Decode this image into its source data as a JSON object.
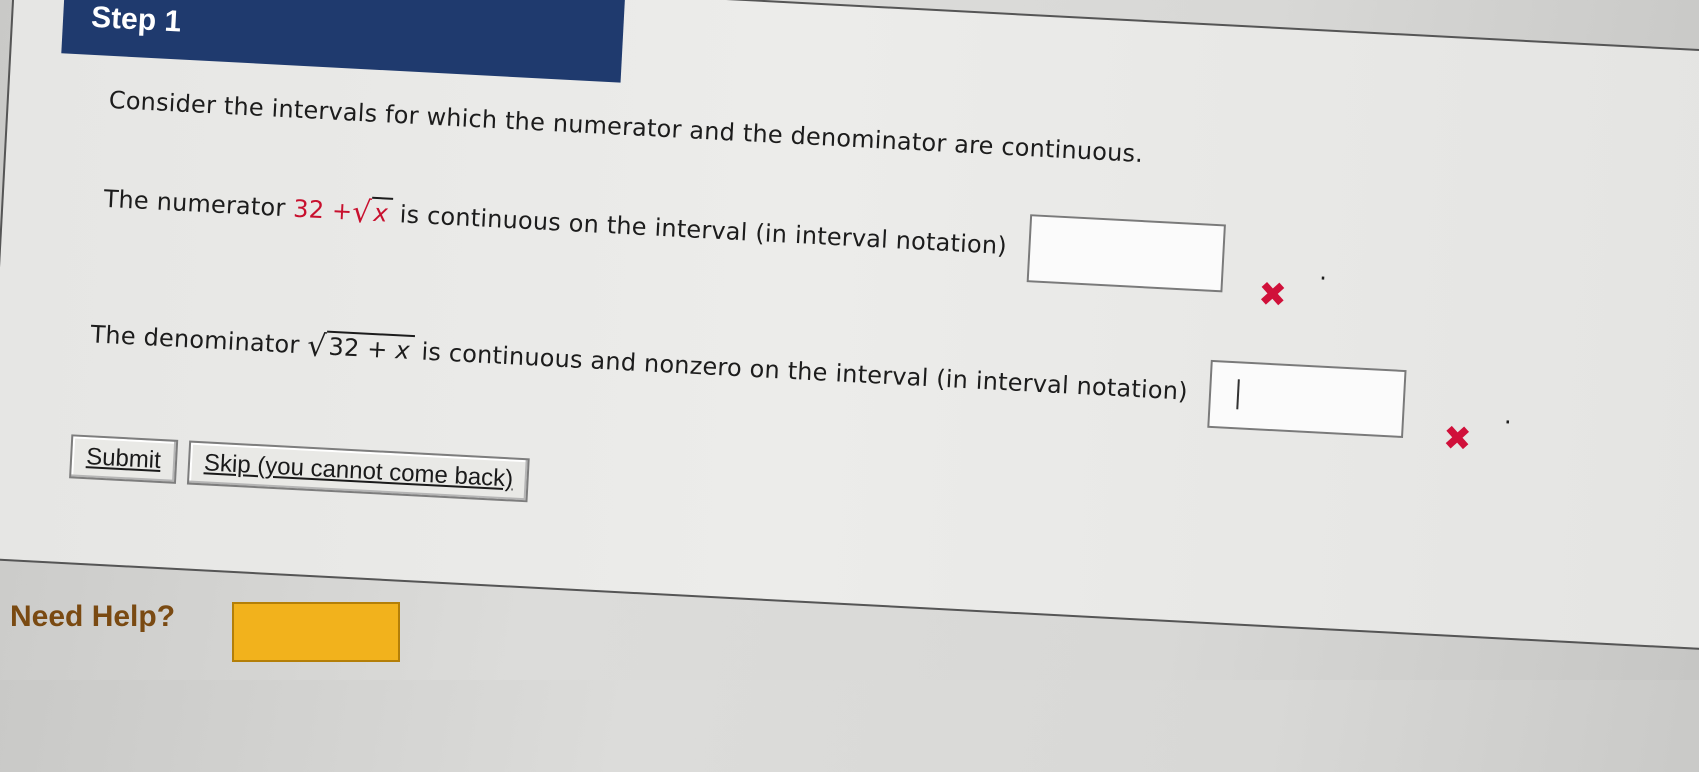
{
  "step": {
    "title": "Step 1"
  },
  "intro": "Consider the intervals for which the numerator and the denominator are continuous.",
  "numerator_line": {
    "prefix": "The numerator",
    "expr_const": "32 +",
    "expr_radicand": "x",
    "suffix": "is continuous on the interval (in interval notation)",
    "answer_value": "",
    "status": "incorrect"
  },
  "denominator_line": {
    "prefix": "The denominator",
    "expr_radicand_const": "32 + ",
    "expr_radicand_var": "x",
    "suffix": "is continuous and nonzero on the interval (in interval notation)",
    "answer_value": "",
    "status": "incorrect"
  },
  "buttons": {
    "submit_label": "Submit",
    "skip_label": "Skip (you cannot come back)"
  },
  "help": {
    "label": "Need Help?"
  },
  "icons": {
    "incorrect": "x-mark-icon",
    "radical": "square-root-icon"
  },
  "colors": {
    "header_bg": "#1f3a6e",
    "math_red": "#c8102e",
    "wrong_mark": "#d0103a",
    "help_button": "#f2b21c"
  }
}
